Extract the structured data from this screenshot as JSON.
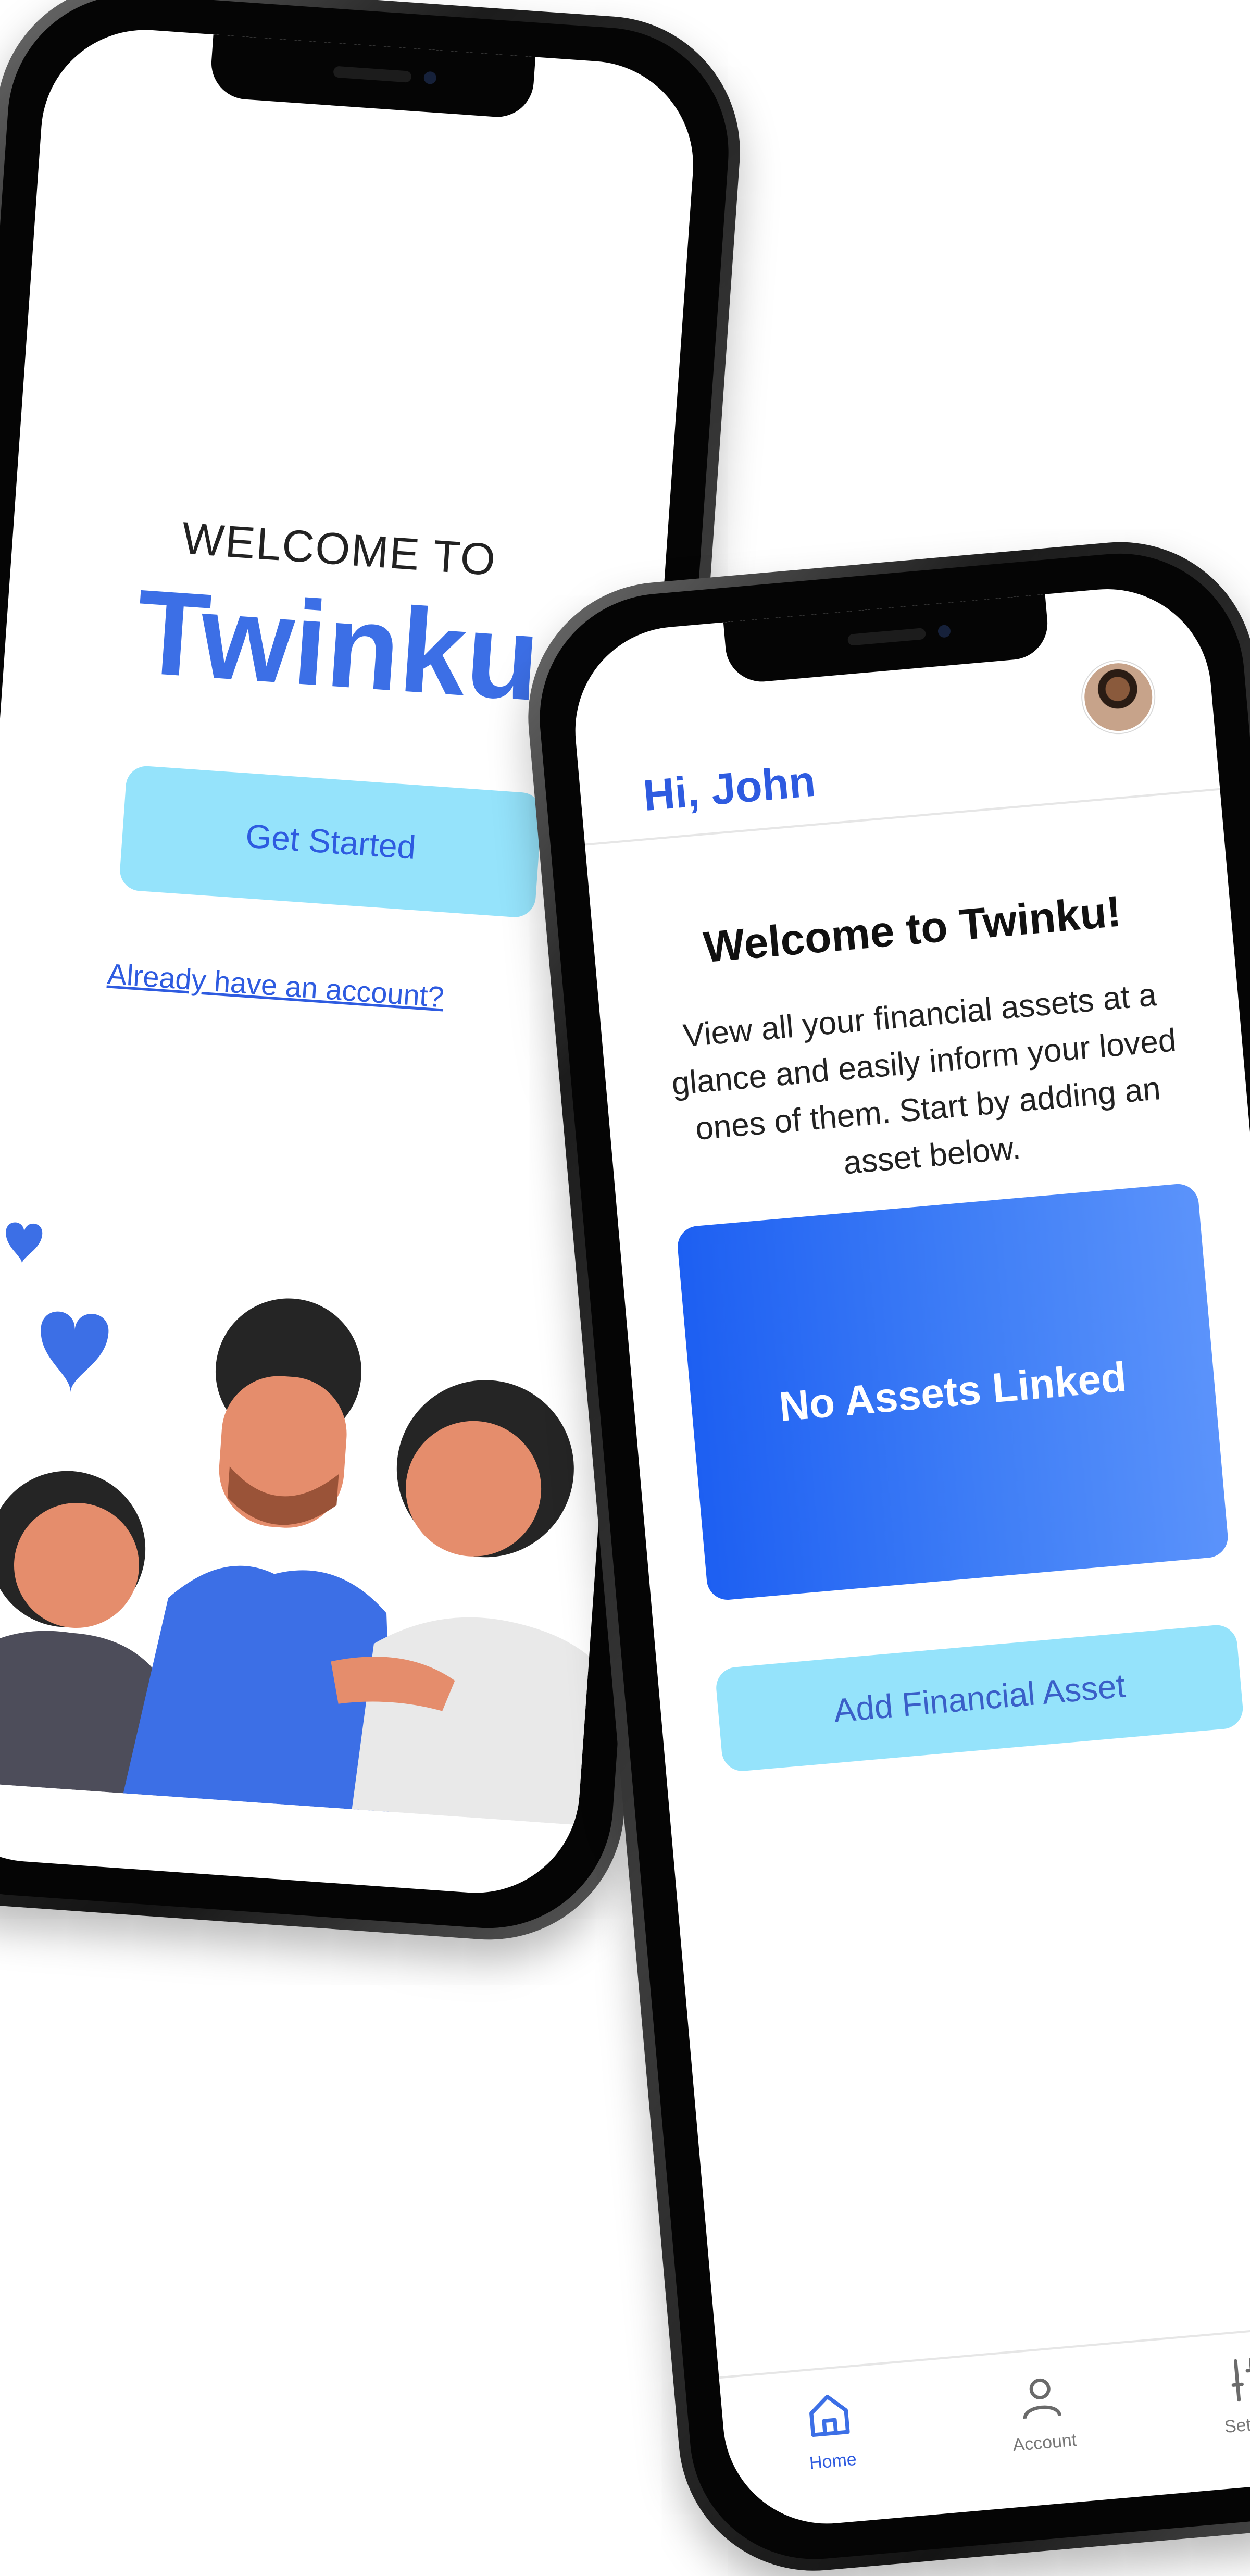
{
  "welcome_screen": {
    "welcome_label": "WELCOME TO",
    "brand": "Twinku",
    "get_started_label": "Get Started",
    "account_link": "Already have an account?"
  },
  "home_screen": {
    "greeting": "Hi, John",
    "title": "Welcome to Twinku!",
    "description": "View all your financial assets at a glance and easily inform your loved ones of them. Start by adding an asset below.",
    "assets_card_label": "No Assets Linked",
    "add_asset_label": "Add Financial Asset",
    "tabs": [
      {
        "label": "Home",
        "icon": "home-icon",
        "active": true
      },
      {
        "label": "Account",
        "icon": "person-icon",
        "active": false
      },
      {
        "label": "Settings",
        "icon": "sliders-icon",
        "active": false
      }
    ]
  },
  "colors": {
    "brand_blue": "#3c6fe6",
    "accent_light_blue": "#95e3fb",
    "card_blue": "#1d5ff2"
  }
}
